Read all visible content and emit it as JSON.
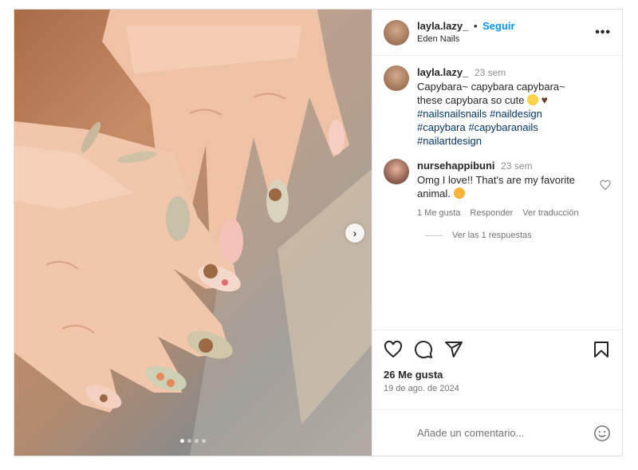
{
  "post": {
    "author": "layla.lazy_",
    "separator": "•",
    "follow_label": "Seguir",
    "location": "Eden Nails",
    "more_label": "•••"
  },
  "photo": {
    "next_label": "›",
    "carousel_dots": 4,
    "active_dot": 0
  },
  "caption": {
    "author": "layla.lazy_",
    "time": "23 sem",
    "text": "Capybara~ capybara capybara~ these capybara so cute",
    "hashtags": [
      "#nailsnailsnails",
      "#naildesign",
      "#capybara",
      "#capybaranails",
      "#nailartdesign"
    ],
    "emojis": [
      "grinning-squinting-face",
      "brown-heart"
    ]
  },
  "comment": {
    "author": "nursehappibuni",
    "time": "23 sem",
    "text": "Omg I love!! That's are my favorite animal.",
    "emoji": "smiling-face-with-heart-eyes",
    "likes": "1 Me gusta",
    "reply_label": "Responder",
    "translate_label": "Ver traducción",
    "view_replies_label": "Ver las 1 respuestas"
  },
  "actions": {
    "icons": [
      "heart-icon",
      "comment-icon",
      "share-icon",
      "bookmark-icon"
    ],
    "like_count": "26 Me gusta",
    "date": "19 de ago. de 2024"
  },
  "add_comment": {
    "placeholder": "Añade un comentario...",
    "emoji_icon": "smiley-icon"
  },
  "colors": {
    "link_blue": "#0095f6",
    "hashtag": "#00376b",
    "muted": "#737373",
    "border": "#dbdbdb"
  }
}
